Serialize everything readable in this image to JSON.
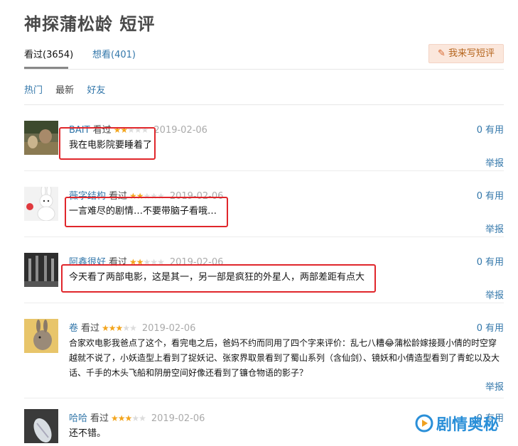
{
  "page_title": "神探蒲松龄 短评",
  "tabs": [
    {
      "label": "看过(3654)"
    },
    {
      "label": "想看(401)"
    }
  ],
  "write_button": "我来写短评",
  "sorts": [
    "热门",
    "最新",
    "好友"
  ],
  "seen_word": "看过",
  "useful_label": "有用",
  "report_label": "举报",
  "comments": [
    {
      "user": "BAIT",
      "stars": 2,
      "time": "2019-02-06",
      "useful": "0",
      "text": "我在电影院要睡着了"
    },
    {
      "user": "薇字结构",
      "stars": 2,
      "time": "2019-02-06",
      "useful": "0",
      "text": "一言难尽的剧情…不要带脑子看哦…"
    },
    {
      "user": "阿鑫很好",
      "stars": 2,
      "time": "2019-02-06",
      "useful": "0",
      "text": "今天看了两部电影，这是其一，另一部是疯狂的外星人，两部差距有点大"
    },
    {
      "user": "卷",
      "stars": 3,
      "time": "2019-02-06",
      "useful": "0",
      "text": "合家欢电影我爸点了这个，看完电之后，爸妈不约而同用了四个字来评价：乱七八糟😂蒲松龄嫁接聂小倩的时空穿越就不说了，小妖造型上看到了捉妖记、张家界取景看到了蜀山系列（含仙剑）、镜妖和小倩造型看到了青蛇以及大话、千手的木头飞船和阴册空间好像还看到了镰仓物语的影子？"
    },
    {
      "user": "哈哈",
      "stars": 3,
      "time": "2019-02-06",
      "useful": "0",
      "text": "还不错。"
    }
  ],
  "watermark": "剧情奥秘",
  "colors": {
    "link": "#3377aa",
    "star": "#f3a51d",
    "highlight": "#e0262b"
  }
}
